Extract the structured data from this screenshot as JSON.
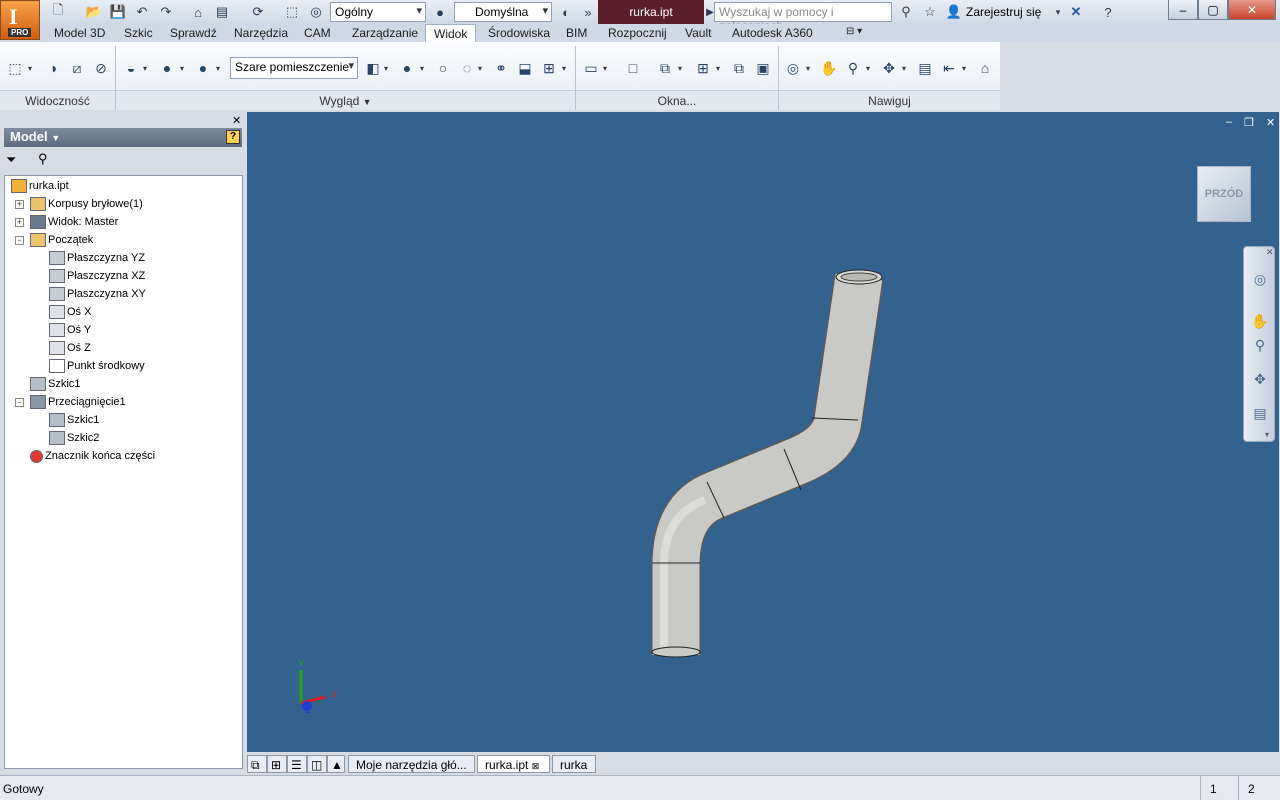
{
  "app": {
    "badge": "PRO",
    "logo_letter": "I"
  },
  "quick_access": {
    "appearance_combo": "Ogólny",
    "material_combo": "Domyślna",
    "document_title": "rurka.ipt",
    "search_placeholder": "Wyszukaj w pomocy i poleceniach",
    "sign_in": "Zarejestruj się"
  },
  "menu_tabs": [
    "Model 3D",
    "Szkic",
    "Sprawdź",
    "Narzędzia",
    "CAM",
    "Zarządzanie",
    "Widok",
    "Środowiska",
    "BIM",
    "Rozpocznij",
    "Vault",
    "Autodesk A360"
  ],
  "ribbon": {
    "visual_style_combo": "Szare pomieszczenie",
    "panels": [
      {
        "label": "Widoczność"
      },
      {
        "label": "Wygląd"
      },
      {
        "label": "Okna..."
      },
      {
        "label": "Nawiguj"
      }
    ]
  },
  "browser": {
    "title": "Model",
    "tree": [
      {
        "label": "rurka.ipt",
        "icon": "part-icon"
      },
      {
        "label": "Korpusy bryłowe(1)",
        "icon": "folder-icon"
      },
      {
        "label": "Widok: Master",
        "icon": "view-icon"
      },
      {
        "label": "Początek",
        "icon": "folder-icon"
      },
      {
        "label": "Płaszczyzna YZ",
        "icon": "plane-icon"
      },
      {
        "label": "Płaszczyzna XZ",
        "icon": "plane-icon"
      },
      {
        "label": "Płaszczyzna XY",
        "icon": "plane-icon"
      },
      {
        "label": "Oś X",
        "icon": "axis-icon"
      },
      {
        "label": "Oś Y",
        "icon": "axis-icon"
      },
      {
        "label": "Oś Z",
        "icon": "axis-icon"
      },
      {
        "label": "Punkt środkowy",
        "icon": "point-icon"
      },
      {
        "label": "Szkic1",
        "icon": "sketch-icon"
      },
      {
        "label": "Przeciągnięcie1",
        "icon": "sweep-icon"
      },
      {
        "label": "Szkic1",
        "icon": "sketch-icon"
      },
      {
        "label": "Szkic2",
        "icon": "sketch-icon"
      },
      {
        "label": "Znacznik końca części",
        "icon": "end-of-part-icon"
      }
    ]
  },
  "viewport": {
    "viewcube_face": "PRZÓD",
    "axis_labels": {
      "y": "Y",
      "x": "X",
      "z": "Z"
    },
    "background_color": "#34628f"
  },
  "document_tabs": [
    "Moje narzędzia głó...",
    "rurka.ipt",
    "rurka"
  ],
  "status": {
    "text": "Gotowy",
    "num1": "1",
    "num2": "2"
  }
}
